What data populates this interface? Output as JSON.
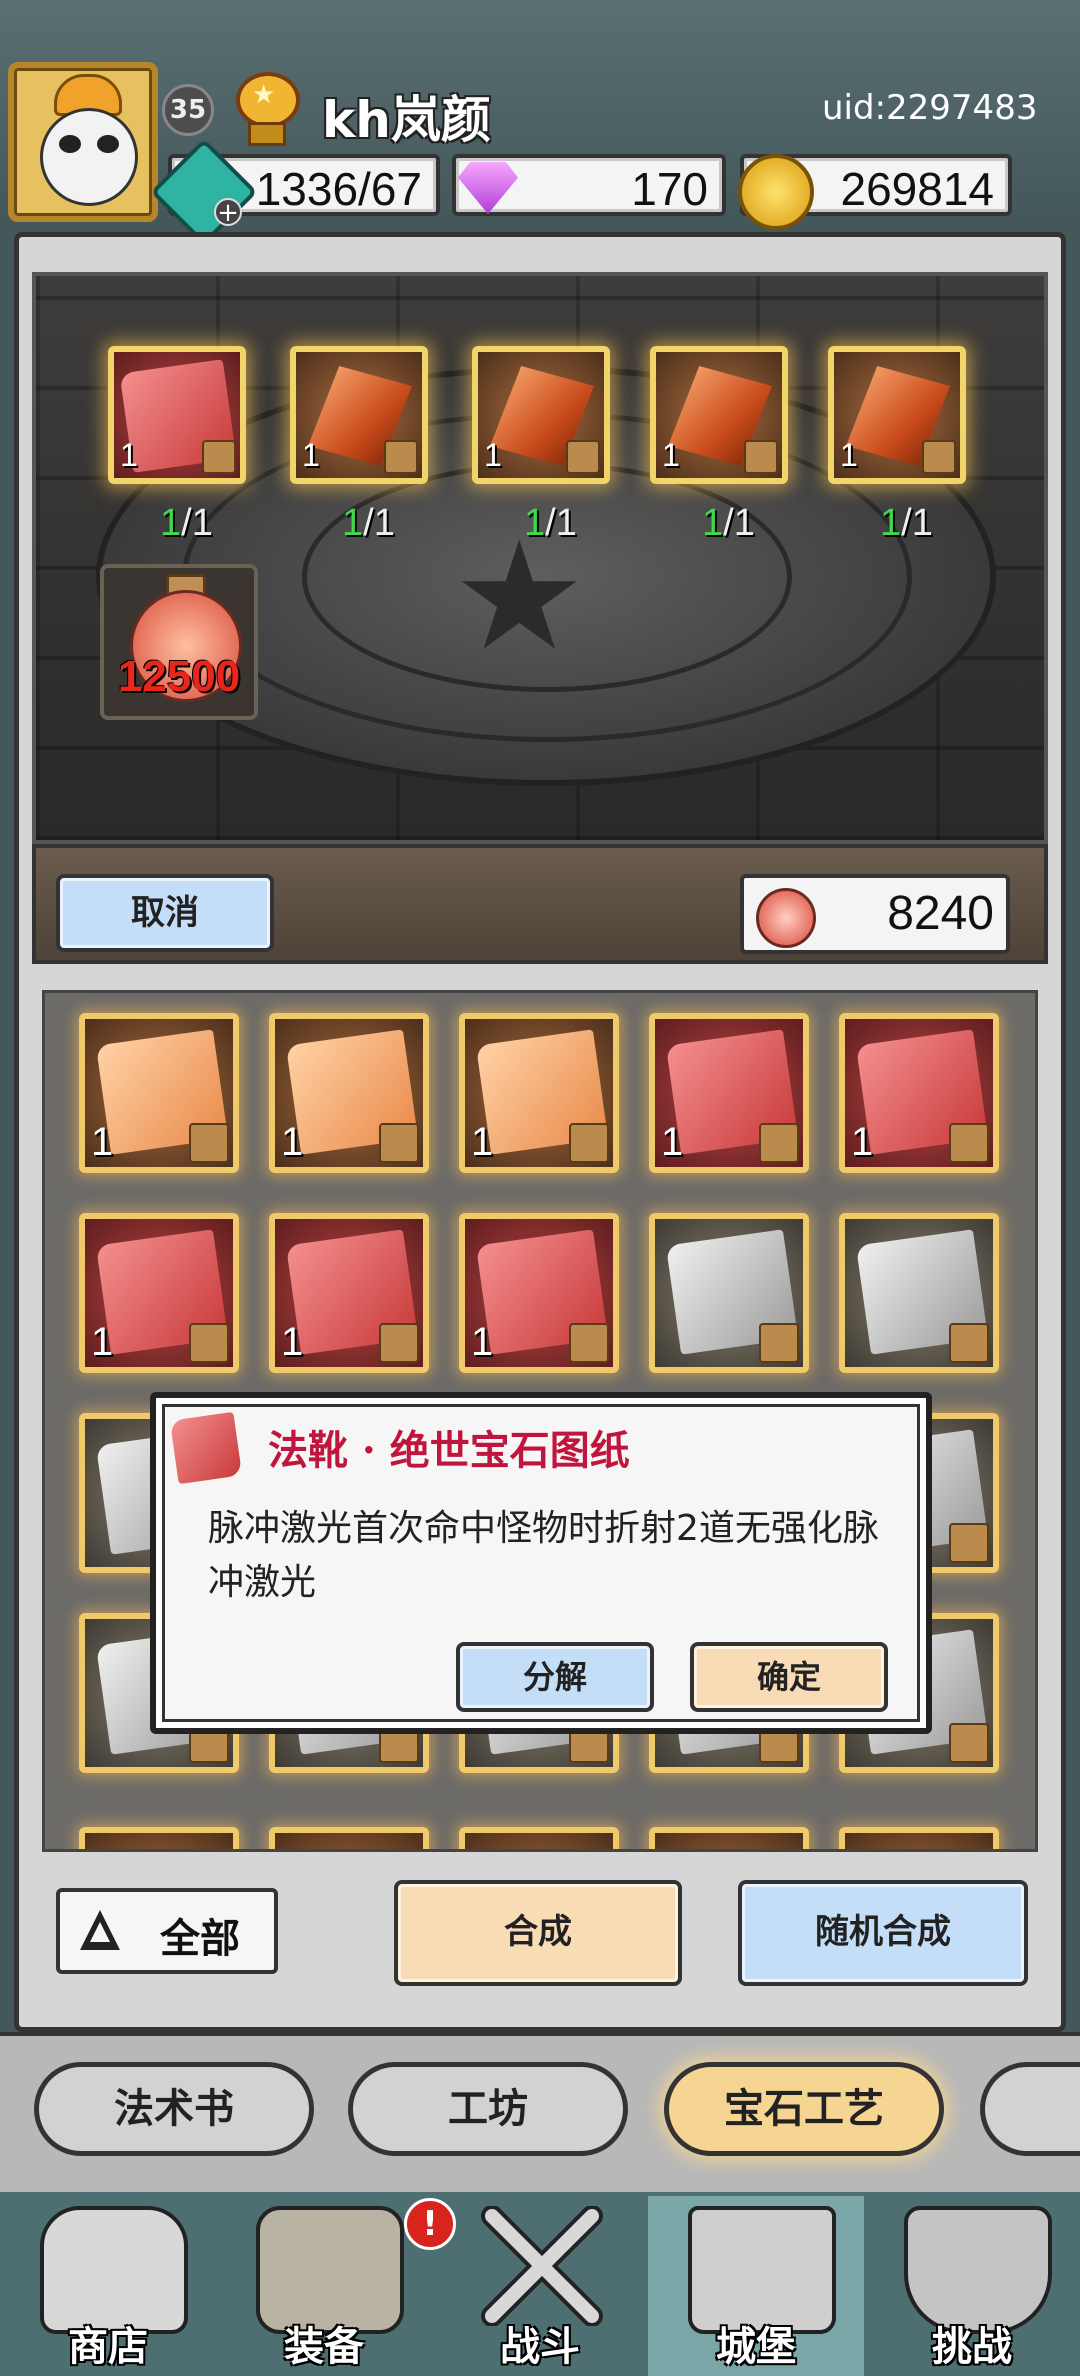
{
  "header": {
    "level": "35",
    "username": "kh岚颜",
    "uid": "uid:2297483",
    "resources": {
      "energy": "1336/67",
      "gems": "170",
      "gold": "269814"
    }
  },
  "altar": {
    "slots": [
      {
        "qty": "1",
        "count_have": "1",
        "count_need": "/1",
        "item": "scroll-red"
      },
      {
        "qty": "1",
        "count_have": "1",
        "count_need": "/1",
        "item": "crystal"
      },
      {
        "qty": "1",
        "count_have": "1",
        "count_need": "/1",
        "item": "crystal"
      },
      {
        "qty": "1",
        "count_have": "1",
        "count_need": "/1",
        "item": "crystal"
      },
      {
        "qty": "1",
        "count_have": "1",
        "count_need": "/1",
        "item": "crystal"
      }
    ],
    "potion_cost": "12500",
    "cancel_label": "取消",
    "potion_owned": "8240"
  },
  "inventory": {
    "rows": [
      [
        {
          "qty": "1",
          "type": "orange"
        },
        {
          "qty": "1",
          "type": "orange"
        },
        {
          "qty": "1",
          "type": "orange"
        },
        {
          "qty": "1",
          "type": "red"
        },
        {
          "qty": "1",
          "type": "red"
        }
      ],
      [
        {
          "qty": "1",
          "type": "red"
        },
        {
          "qty": "1",
          "type": "red"
        },
        {
          "qty": "1",
          "type": "red"
        },
        {
          "qty": "",
          "type": "gray"
        },
        {
          "qty": "",
          "type": "gray"
        }
      ]
    ]
  },
  "dialog": {
    "title": "法靴 · 绝世宝石图纸",
    "description": "脉冲激光首次命中怪物时折射2道无强化脉冲激光",
    "decompose_label": "分解",
    "confirm_label": "确定"
  },
  "actions": {
    "filter_label": "全部",
    "synthesize_label": "合成",
    "random_synthesize_label": "随机合成"
  },
  "tabs": [
    {
      "label": "法术书"
    },
    {
      "label": "工坊"
    },
    {
      "label": "宝石工艺",
      "active": true
    }
  ],
  "bottom_nav": [
    {
      "label": "商店",
      "icon": "shop-icon"
    },
    {
      "label": "装备",
      "icon": "backpack-icon",
      "badge": "!"
    },
    {
      "label": "战斗",
      "icon": "crossed-swords-icon"
    },
    {
      "label": "城堡",
      "icon": "castle-icon",
      "active": true
    },
    {
      "label": "挑战",
      "icon": "shield-icon"
    }
  ],
  "colors": {
    "accent_gold": "#f1d56b",
    "dialog_title": "#c0153c",
    "button_blue": "#c5def7",
    "button_cream": "#f8dcb6",
    "count_green": "#3fd94a"
  }
}
